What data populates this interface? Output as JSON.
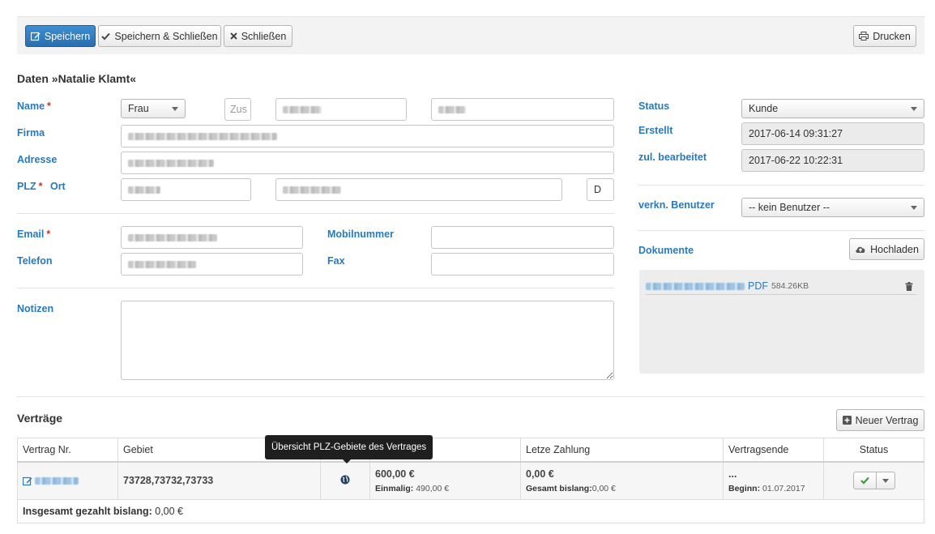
{
  "toolbar": {
    "save": "Speichern",
    "save_close": "Speichern & Schließen",
    "close": "Schließen",
    "print": "Drucken"
  },
  "header": {
    "title": "Daten »Natalie Klamt«"
  },
  "form": {
    "name_label": "Name",
    "required_mark": "*",
    "salutation": "Frau",
    "zus_placeholder": "Zus",
    "firma_label": "Firma",
    "adresse_label": "Adresse",
    "plz_label": "PLZ",
    "ort_label": "Ort",
    "country": "D",
    "email_label": "Email",
    "mobil_label": "Mobilnummer",
    "telefon_label": "Telefon",
    "fax_label": "Fax",
    "notizen_label": "Notizen"
  },
  "side": {
    "status_label": "Status",
    "status_value": "Kunde",
    "created_label": "Erstellt",
    "created_value": "2017-06-14 09:31:27",
    "edited_label": "zul. bearbeitet",
    "edited_value": "2017-06-22 10:22:31",
    "user_label": "verkn. Benutzer",
    "user_value": "-- kein Benutzer --",
    "docs_label": "Dokumente",
    "upload": "Hochladen",
    "doc_type": "PDF",
    "doc_size": "584.26KB"
  },
  "contracts": {
    "title": "Verträge",
    "new_button": "Neuer Vertrag",
    "tooltip": "Übersicht PLZ-Gebiete des Vertrages",
    "headers": {
      "nr": "Vertrag Nr.",
      "gebiet": "Gebiet",
      "zahlung": "Letze Zahlung",
      "ende": "Vertragsende",
      "status": "Status"
    },
    "row": {
      "gebiet": "73728,73732,73733",
      "amount": "600,00 €",
      "einmalig_label": "Einmalig:",
      "einmalig_value": "490,00 €",
      "last_payment": "0,00 €",
      "gesamt_label": "Gesamt bislang:",
      "gesamt_value": "0,00 €",
      "ende": "...",
      "beginn_label": "Beginn:",
      "beginn_value": "01.07.2017"
    },
    "total_label": "Insgesamt gezahlt bislang:",
    "total_value": "0,00 €"
  },
  "colors": {
    "primary": "#2a6fae",
    "label": "#2a79b8",
    "required": "#c0392b",
    "success": "#3c9a3c"
  }
}
